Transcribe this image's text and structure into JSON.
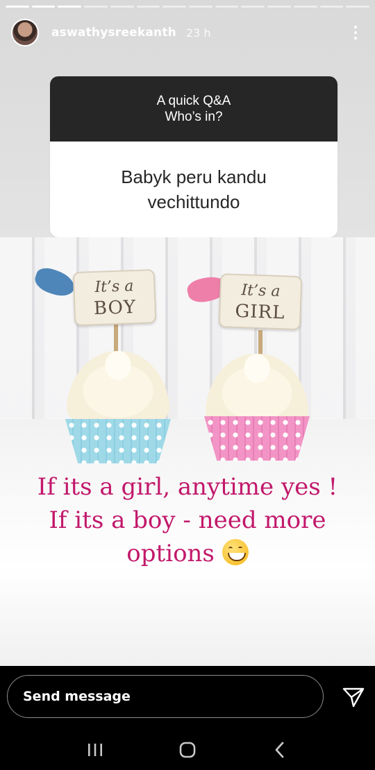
{
  "story": {
    "progress_segments": 14,
    "progress_done": 3,
    "username": "aswathysreekanth",
    "time": "23 h",
    "menu_icon": "more-vertical-icon",
    "avatar_icon": "profile-avatar"
  },
  "qa": {
    "prompt_line1": "A quick Q&A",
    "prompt_line2": "Who’s in?",
    "answer": "Babyk peru kandu vechittundo"
  },
  "photo": {
    "topper_boy_line1": "It’s a",
    "topper_boy_line2": "BOY",
    "topper_girl_line1": "It’s a",
    "topper_girl_line2": "GIRL",
    "caption_line1": "If its a girl, anytime yes !",
    "caption_line2": "If its a boy - need more",
    "caption_line3": "options",
    "caption_emoji": "grinning-face-emoji",
    "caption_color": "#c2186b"
  },
  "footer": {
    "send_message_label": "Send message",
    "send_icon": "paper-plane-icon",
    "nav": [
      "recents-icon",
      "home-icon",
      "back-icon"
    ]
  }
}
